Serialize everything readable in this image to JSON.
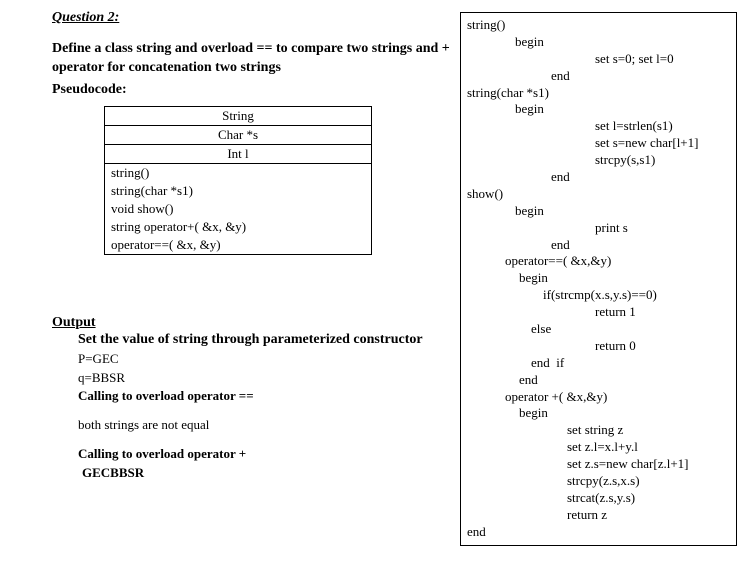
{
  "question_title": "Question 2:",
  "prompt": "Define a class string and overload == to compare two strings and + operator for concatenation two strings",
  "pseudocode_label": "Pseudocode:",
  "class_table": {
    "name": "String",
    "member1": "Char *s",
    "member2": "Int l",
    "methods": [
      "string()",
      "string(char *s1)",
      "void show()",
      "string operator+( &x, &y)",
      "operator==( &x, &y)"
    ]
  },
  "output": {
    "heading": "Output",
    "line_set_value": "Set the value of string through parameterized constructor",
    "p_assign": "P=GEC",
    "q_assign": "q=BBSR",
    "call_eq": "Calling to overload operator  ==",
    "not_equal": "both  strings are not equal",
    "call_plus": "Calling to overload operator  +",
    "result": "GECBBSR"
  },
  "code": {
    "l1": "string()",
    "l2": "begin",
    "l3": "set s=0; set l=0",
    "l4": "end",
    "l5": "string(char *s1)",
    "l6": "begin",
    "l7": "set l=strlen(s1)",
    "l8": "set s=new char[l+1]",
    "l9": "strcpy(s,s1)",
    "l10": "end",
    "l11": "show()",
    "l12": "begin",
    "l13": "print s",
    "l14": "end",
    "l15": "operator==( &x,&y)",
    "l16": "begin",
    "l17": "if(strcmp(x.s,y.s)==0)",
    "l18": "return 1",
    "l19": "else",
    "l20": "return 0",
    "l21": "end  if",
    "l22": "end",
    "l23": "operator +( &x,&y)",
    "l24": "begin",
    "l25": "set string z",
    "l26": "set z.l=x.l+y.l",
    "l27": "set z.s=new char[z.l+1]",
    "l28": "strcpy(z.s,x.s)",
    "l29": "strcat(z.s,y.s)",
    "l30": "return z",
    "l31": "end"
  }
}
